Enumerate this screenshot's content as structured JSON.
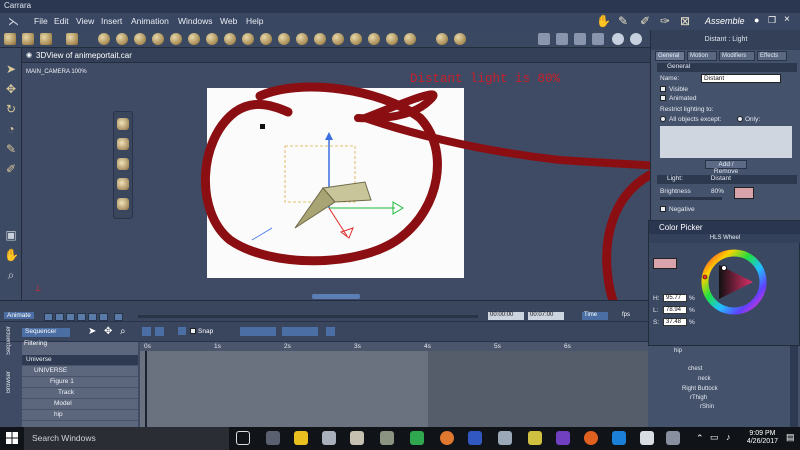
{
  "app": {
    "title": "Carrara",
    "room": "Assemble"
  },
  "menu": [
    "File",
    "Edit",
    "View",
    "Insert",
    "Animation",
    "Windows",
    "Web",
    "Help"
  ],
  "viewport": {
    "title": "3DView of animeportait.car",
    "camera_label": "MAIN_CAMERA 100%"
  },
  "annotation": {
    "text": "Distant light is 80%"
  },
  "properties": {
    "header": "Distant : Light",
    "tabs": [
      "General",
      "Motion",
      "Modifiers",
      "Effects"
    ],
    "general_section": "General",
    "name_label": "Name:",
    "name_value": "Distant",
    "visible_label": "Visible",
    "animated_label": "Animated",
    "restrict_label": "Restrict lighting to:",
    "all_except_label": "All objects except:",
    "only_label": "Only:",
    "add_remove": "Add / Remove",
    "light_section": "Light:",
    "light_type": "Distant",
    "brightness_label": "Brightness",
    "brightness_value": "80%",
    "negative_label": "Negative",
    "light_color": "#d9a3ab"
  },
  "color_picker": {
    "title": "Color Picker",
    "mode": "HLS Wheel",
    "h_label": "H:",
    "h_value": "95.77",
    "l_label": "L:",
    "l_value": "78.94",
    "s_label": "S:",
    "s_value": "37.48",
    "pct": "%",
    "swatch_color": "#d9a3ab"
  },
  "timeline": {
    "animate_label": "Animate",
    "time_start": "00:00:00",
    "time_end": "00:07:00",
    "time_unit": "Time",
    "fps_label": "fps",
    "sequencer_label": "Sequencer",
    "snap_label": "Snap",
    "filtering_label": "Filtering",
    "side_sequencer": "Sequencer",
    "side_browser": "Browser",
    "ruler": [
      "0s",
      "1s",
      "2s",
      "3s",
      "4s",
      "5s",
      "6s"
    ],
    "tracks": [
      "Universe",
      "UNIVERSE",
      "Figure 1",
      "Track",
      "Model",
      "hip"
    ]
  },
  "hierarchy": {
    "items": [
      "hip",
      "chest",
      "neck",
      "Right Buttock",
      "rThigh",
      "rShin"
    ]
  },
  "taskbar": {
    "search_placeholder": "Search Windows",
    "time": "9:09 PM",
    "date": "4/26/2017"
  }
}
